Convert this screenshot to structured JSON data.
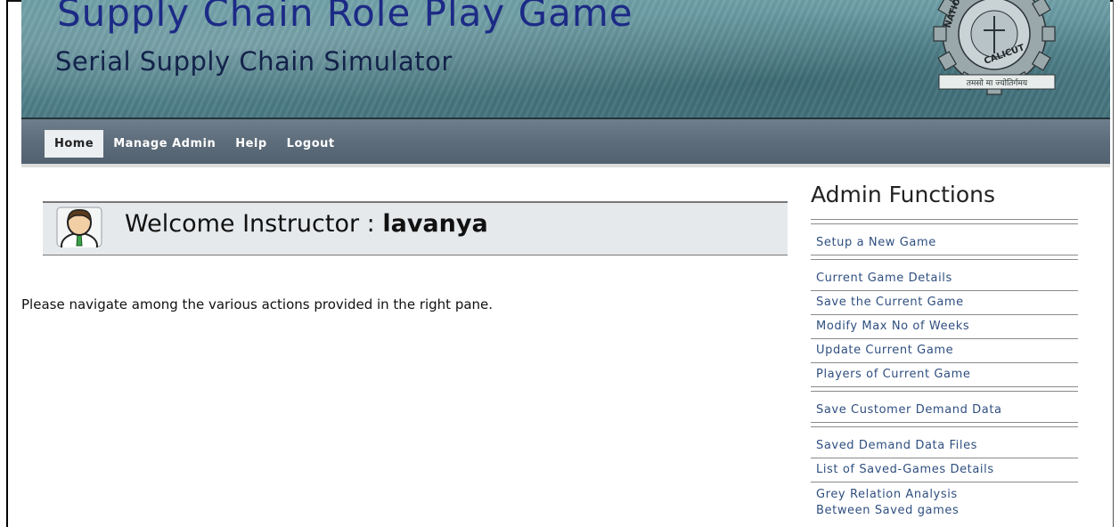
{
  "header": {
    "title": "Supply Chain Role Play Game",
    "subtitle": "Serial Supply Chain Simulator",
    "logo": {
      "icon": "institute-gear-logo",
      "text_top": "NATIONAL",
      "text_right": "CALICUT",
      "motto": "तमसो मा ज्योतिर्गमय"
    }
  },
  "nav": {
    "items": [
      {
        "label": "Home",
        "active": true
      },
      {
        "label": "Manage Admin",
        "active": false
      },
      {
        "label": "Help",
        "active": false
      },
      {
        "label": "Logout",
        "active": false
      }
    ]
  },
  "main": {
    "welcome_prefix": "Welcome Instructor : ",
    "username": "lavanya",
    "avatar_icon": "user-avatar-icon",
    "instructions": "Please navigate among the various actions provided in the right pane."
  },
  "sidebar": {
    "title": "Admin Functions",
    "links": [
      {
        "label": "Setup a New Game"
      },
      {
        "label": "Current Game Details"
      },
      {
        "label": "Save the Current Game"
      },
      {
        "label": "Modify Max No of Weeks"
      },
      {
        "label": "Update Current Game"
      },
      {
        "label": "Players of Current Game"
      },
      {
        "label": "Save Customer Demand Data"
      },
      {
        "label": "Saved Demand Data Files"
      },
      {
        "label": "List of Saved-Games Details"
      },
      {
        "label": "Grey Relation Analysis"
      },
      {
        "label": "Between Saved games"
      }
    ]
  },
  "colors": {
    "banner": "#5a8b94",
    "title": "#1c2a86",
    "nav": "#5e6d7b",
    "link": "#2f4f7f"
  }
}
